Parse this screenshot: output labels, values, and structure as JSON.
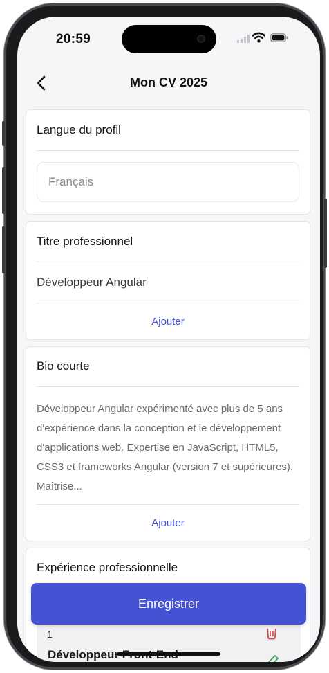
{
  "status_bar": {
    "time": "20:59"
  },
  "header": {
    "title": "Mon CV 2025"
  },
  "language": {
    "title": "Langue du profil",
    "value": "Français"
  },
  "job_title": {
    "title": "Titre professionnel",
    "value": "Développeur Angular",
    "add_label": "Ajouter"
  },
  "bio": {
    "title": "Bio courte",
    "text": "Développeur Angular expérimenté avec plus de 5 ans d'expérience dans la conception et le développement d'applications web. Expertise en JavaScript, HTML5, CSS3 et frameworks Angular (version 7 et supérieures). Maîtrise...",
    "add_label": "Ajouter"
  },
  "experience": {
    "title": "Expérience professionnelle",
    "items": [
      {
        "index": "1",
        "role": "Développeur Front-End"
      }
    ]
  },
  "save_label": "Enregistrer",
  "colors": {
    "accent": "#4452d4",
    "delete": "#d64545",
    "edit": "#3f9e5a"
  },
  "icons": {
    "back": "chevron-left-icon",
    "delete": "trash-icon",
    "edit": "pencil-icon"
  }
}
